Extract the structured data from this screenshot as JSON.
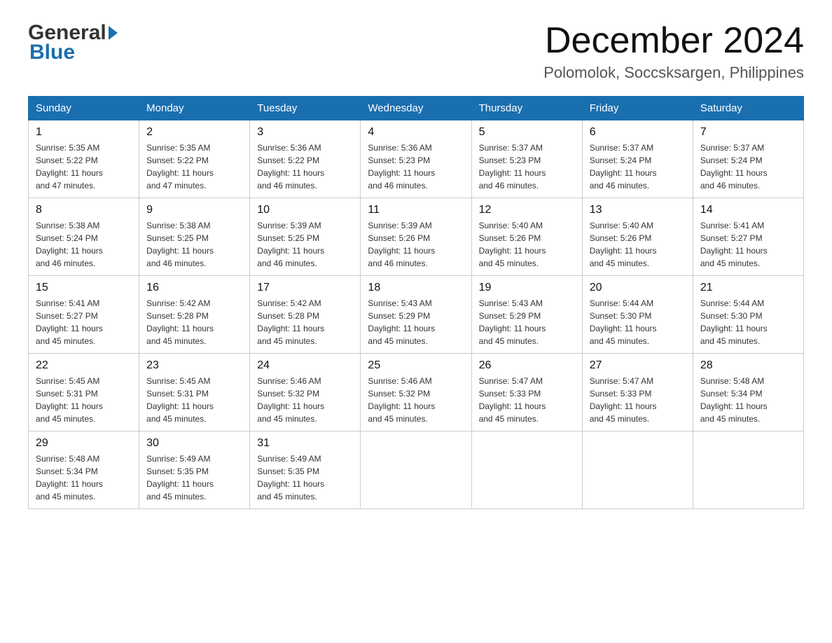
{
  "header": {
    "logo_general": "General",
    "logo_blue": "Blue",
    "month_title": "December 2024",
    "subtitle": "Polomolok, Soccsksargen, Philippines"
  },
  "days_of_week": [
    "Sunday",
    "Monday",
    "Tuesday",
    "Wednesday",
    "Thursday",
    "Friday",
    "Saturday"
  ],
  "weeks": [
    [
      {
        "day": "1",
        "info": "Sunrise: 5:35 AM\nSunset: 5:22 PM\nDaylight: 11 hours\nand 47 minutes."
      },
      {
        "day": "2",
        "info": "Sunrise: 5:35 AM\nSunset: 5:22 PM\nDaylight: 11 hours\nand 47 minutes."
      },
      {
        "day": "3",
        "info": "Sunrise: 5:36 AM\nSunset: 5:22 PM\nDaylight: 11 hours\nand 46 minutes."
      },
      {
        "day": "4",
        "info": "Sunrise: 5:36 AM\nSunset: 5:23 PM\nDaylight: 11 hours\nand 46 minutes."
      },
      {
        "day": "5",
        "info": "Sunrise: 5:37 AM\nSunset: 5:23 PM\nDaylight: 11 hours\nand 46 minutes."
      },
      {
        "day": "6",
        "info": "Sunrise: 5:37 AM\nSunset: 5:24 PM\nDaylight: 11 hours\nand 46 minutes."
      },
      {
        "day": "7",
        "info": "Sunrise: 5:37 AM\nSunset: 5:24 PM\nDaylight: 11 hours\nand 46 minutes."
      }
    ],
    [
      {
        "day": "8",
        "info": "Sunrise: 5:38 AM\nSunset: 5:24 PM\nDaylight: 11 hours\nand 46 minutes."
      },
      {
        "day": "9",
        "info": "Sunrise: 5:38 AM\nSunset: 5:25 PM\nDaylight: 11 hours\nand 46 minutes."
      },
      {
        "day": "10",
        "info": "Sunrise: 5:39 AM\nSunset: 5:25 PM\nDaylight: 11 hours\nand 46 minutes."
      },
      {
        "day": "11",
        "info": "Sunrise: 5:39 AM\nSunset: 5:26 PM\nDaylight: 11 hours\nand 46 minutes."
      },
      {
        "day": "12",
        "info": "Sunrise: 5:40 AM\nSunset: 5:26 PM\nDaylight: 11 hours\nand 45 minutes."
      },
      {
        "day": "13",
        "info": "Sunrise: 5:40 AM\nSunset: 5:26 PM\nDaylight: 11 hours\nand 45 minutes."
      },
      {
        "day": "14",
        "info": "Sunrise: 5:41 AM\nSunset: 5:27 PM\nDaylight: 11 hours\nand 45 minutes."
      }
    ],
    [
      {
        "day": "15",
        "info": "Sunrise: 5:41 AM\nSunset: 5:27 PM\nDaylight: 11 hours\nand 45 minutes."
      },
      {
        "day": "16",
        "info": "Sunrise: 5:42 AM\nSunset: 5:28 PM\nDaylight: 11 hours\nand 45 minutes."
      },
      {
        "day": "17",
        "info": "Sunrise: 5:42 AM\nSunset: 5:28 PM\nDaylight: 11 hours\nand 45 minutes."
      },
      {
        "day": "18",
        "info": "Sunrise: 5:43 AM\nSunset: 5:29 PM\nDaylight: 11 hours\nand 45 minutes."
      },
      {
        "day": "19",
        "info": "Sunrise: 5:43 AM\nSunset: 5:29 PM\nDaylight: 11 hours\nand 45 minutes."
      },
      {
        "day": "20",
        "info": "Sunrise: 5:44 AM\nSunset: 5:30 PM\nDaylight: 11 hours\nand 45 minutes."
      },
      {
        "day": "21",
        "info": "Sunrise: 5:44 AM\nSunset: 5:30 PM\nDaylight: 11 hours\nand 45 minutes."
      }
    ],
    [
      {
        "day": "22",
        "info": "Sunrise: 5:45 AM\nSunset: 5:31 PM\nDaylight: 11 hours\nand 45 minutes."
      },
      {
        "day": "23",
        "info": "Sunrise: 5:45 AM\nSunset: 5:31 PM\nDaylight: 11 hours\nand 45 minutes."
      },
      {
        "day": "24",
        "info": "Sunrise: 5:46 AM\nSunset: 5:32 PM\nDaylight: 11 hours\nand 45 minutes."
      },
      {
        "day": "25",
        "info": "Sunrise: 5:46 AM\nSunset: 5:32 PM\nDaylight: 11 hours\nand 45 minutes."
      },
      {
        "day": "26",
        "info": "Sunrise: 5:47 AM\nSunset: 5:33 PM\nDaylight: 11 hours\nand 45 minutes."
      },
      {
        "day": "27",
        "info": "Sunrise: 5:47 AM\nSunset: 5:33 PM\nDaylight: 11 hours\nand 45 minutes."
      },
      {
        "day": "28",
        "info": "Sunrise: 5:48 AM\nSunset: 5:34 PM\nDaylight: 11 hours\nand 45 minutes."
      }
    ],
    [
      {
        "day": "29",
        "info": "Sunrise: 5:48 AM\nSunset: 5:34 PM\nDaylight: 11 hours\nand 45 minutes."
      },
      {
        "day": "30",
        "info": "Sunrise: 5:49 AM\nSunset: 5:35 PM\nDaylight: 11 hours\nand 45 minutes."
      },
      {
        "day": "31",
        "info": "Sunrise: 5:49 AM\nSunset: 5:35 PM\nDaylight: 11 hours\nand 45 minutes."
      },
      {
        "day": "",
        "info": ""
      },
      {
        "day": "",
        "info": ""
      },
      {
        "day": "",
        "info": ""
      },
      {
        "day": "",
        "info": ""
      }
    ]
  ]
}
